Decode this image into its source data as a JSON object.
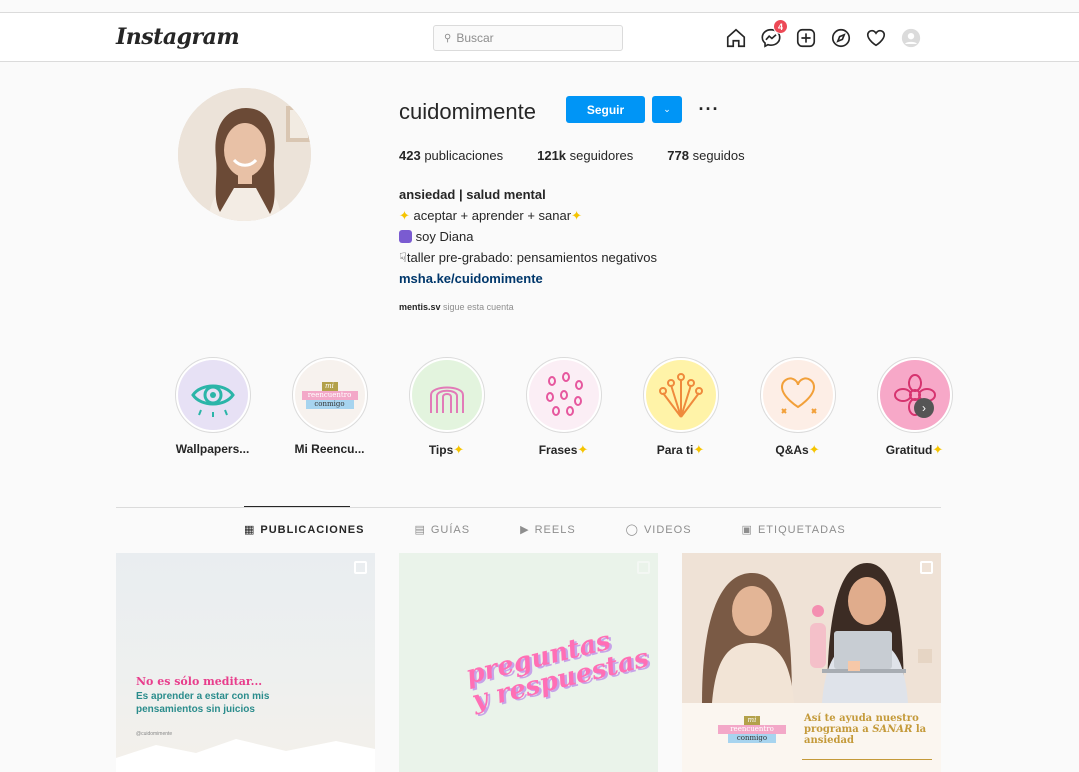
{
  "header": {
    "logo": "Instagram",
    "search_placeholder": "Buscar",
    "messages_badge": "4"
  },
  "profile": {
    "username": "cuidomimente",
    "follow_label": "Seguir",
    "stats": {
      "posts_count": "423",
      "posts_label": "publicaciones",
      "followers_count": "121k",
      "followers_label": "seguidores",
      "following_count": "778",
      "following_label": "seguidos"
    },
    "bio": {
      "name": "ansiedad | salud mental",
      "line1": "aceptar + aprender + sanar",
      "line2": "soy Diana",
      "line3": "taller pre-grabado: pensamientos negativos",
      "link": "msha.ke/cuidomimente"
    },
    "followed_by_user": "mentis.sv",
    "followed_by_text": "sigue esta cuenta"
  },
  "highlights": [
    {
      "label": "Wallpapers..."
    },
    {
      "label": "Mi Reencu..."
    },
    {
      "label": "Tips"
    },
    {
      "label": "Frases"
    },
    {
      "label": "Para ti"
    },
    {
      "label": "Q&As"
    },
    {
      "label": "Gratitud"
    }
  ],
  "highlight_art": {
    "mi": "mi",
    "reencuentro": "reencuentro",
    "conmigo": "conmigo"
  },
  "tabs": [
    {
      "label": "PUBLICACIONES",
      "icon": "grid-icon"
    },
    {
      "label": "GUÍAS",
      "icon": "guide-icon"
    },
    {
      "label": "REELS",
      "icon": "reels-icon"
    },
    {
      "label": "VIDEOS",
      "icon": "video-icon"
    },
    {
      "label": "ETIQUETADAS",
      "icon": "tagged-icon"
    }
  ],
  "posts": {
    "p1": {
      "title": "No es sólo meditar...",
      "body": "Es aprender a estar con mis pensamientos sin juicios",
      "handle": "@cuidomimente"
    },
    "p2": {
      "line1": "preguntas",
      "line2": "y respuestas"
    },
    "p3": {
      "mi": "mi",
      "reencuentro": "reencuentro",
      "conmigo": "conmigo",
      "text_prefix": "Así te ayuda nuestro programa a",
      "text_emph": "SANAR",
      "text_suffix": "la ansiedad"
    }
  },
  "colors": {
    "accent": "#0095f6",
    "link": "#00376b",
    "badge": "#ed4956"
  }
}
